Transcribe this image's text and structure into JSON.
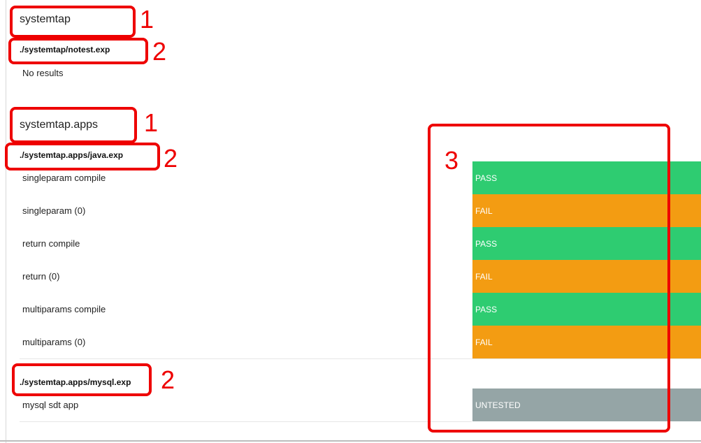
{
  "groups": [
    {
      "title": "systemtap",
      "files": [
        {
          "name": "./systemtap/notest.exp",
          "note": "No results",
          "rows": []
        }
      ]
    },
    {
      "title": "systemtap.apps",
      "files": [
        {
          "name": "./systemtap.apps/java.exp",
          "rows": [
            {
              "label": "singleparam compile",
              "result": "PASS"
            },
            {
              "label": "singleparam (0)",
              "result": "FAIL"
            },
            {
              "label": "return compile",
              "result": "PASS"
            },
            {
              "label": "return (0)",
              "result": "FAIL"
            },
            {
              "label": "multiparams compile",
              "result": "PASS"
            },
            {
              "label": "multiparams (0)",
              "result": "FAIL"
            }
          ]
        },
        {
          "name": "./systemtap.apps/mysql.exp",
          "rows": [
            {
              "label": "mysql sdt app",
              "result": "UNTESTED"
            }
          ]
        }
      ]
    }
  ],
  "annotations": {
    "group_marker": "1",
    "file_marker": "2",
    "results_marker": "3",
    "color": "#ee0000"
  },
  "colors": {
    "pass": "#2ecc71",
    "fail": "#f39c12",
    "untested": "#95a5a6"
  }
}
